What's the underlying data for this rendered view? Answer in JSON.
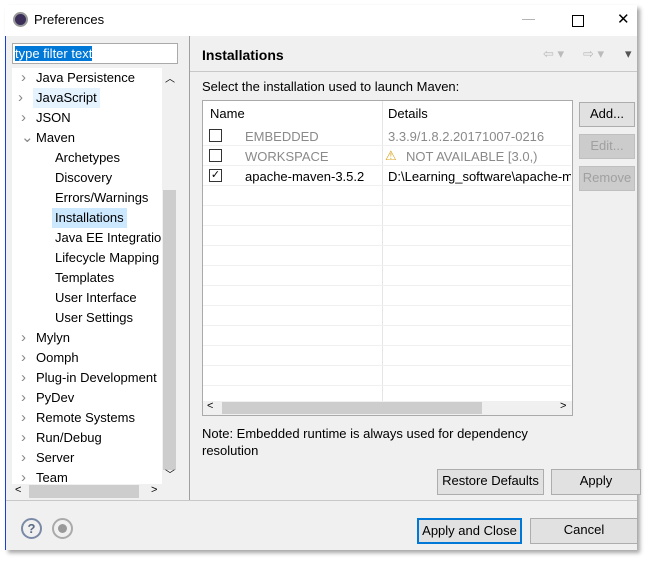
{
  "window": {
    "title": "Preferences",
    "minimize": "—",
    "maximize": "☐",
    "close": "✕"
  },
  "filter": {
    "value": "type filter text"
  },
  "tree": {
    "items": [
      {
        "label": "Java Persistence",
        "expanded": false,
        "level": 0
      },
      {
        "label": "JavaScript",
        "expanded": false,
        "level": 0
      },
      {
        "label": "JSON",
        "expanded": false,
        "level": 0
      },
      {
        "label": "Maven",
        "expanded": true,
        "level": 0
      },
      {
        "label": "Archetypes",
        "level": 1
      },
      {
        "label": "Discovery",
        "level": 1
      },
      {
        "label": "Errors/Warnings",
        "level": 1
      },
      {
        "label": "Installations",
        "level": 1,
        "selected": true
      },
      {
        "label": "Java EE Integration",
        "level": 1
      },
      {
        "label": "Lifecycle Mapping",
        "level": 1
      },
      {
        "label": "Templates",
        "level": 1
      },
      {
        "label": "User Interface",
        "level": 1
      },
      {
        "label": "User Settings",
        "level": 1
      },
      {
        "label": "Mylyn",
        "expanded": false,
        "level": 0
      },
      {
        "label": "Oomph",
        "expanded": false,
        "level": 0
      },
      {
        "label": "Plug-in Development",
        "expanded": false,
        "level": 0
      },
      {
        "label": "PyDev",
        "expanded": false,
        "level": 0
      },
      {
        "label": "Remote Systems",
        "expanded": false,
        "level": 0
      },
      {
        "label": "Run/Debug",
        "expanded": false,
        "level": 0
      },
      {
        "label": "Server",
        "expanded": false,
        "level": 0
      },
      {
        "label": "Team",
        "expanded": false,
        "level": 0
      }
    ]
  },
  "page": {
    "title": "Installations",
    "description": "Select the installation used to launch Maven:",
    "note": "Note: Embedded runtime is always used for dependency resolution"
  },
  "table": {
    "columns": [
      "Name",
      "Details"
    ],
    "rows": [
      {
        "checked": false,
        "name": "EMBEDDED",
        "details": "3.3.9/1.8.2.20171007-0216",
        "disabled": true,
        "warning": false
      },
      {
        "checked": false,
        "name": "WORKSPACE",
        "details": "NOT AVAILABLE [3.0,)",
        "disabled": true,
        "warning": true
      },
      {
        "checked": true,
        "name": "apache-maven-3.5.2",
        "details": "D:\\Learning_software\\apache-m",
        "disabled": false,
        "warning": false
      }
    ]
  },
  "buttons": {
    "add": "Add...",
    "edit": "Edit...",
    "remove": "Remove",
    "restore_defaults": "Restore Defaults",
    "apply": "Apply",
    "apply_close": "Apply and Close",
    "cancel": "Cancel"
  },
  "footer": {
    "help": "?"
  }
}
